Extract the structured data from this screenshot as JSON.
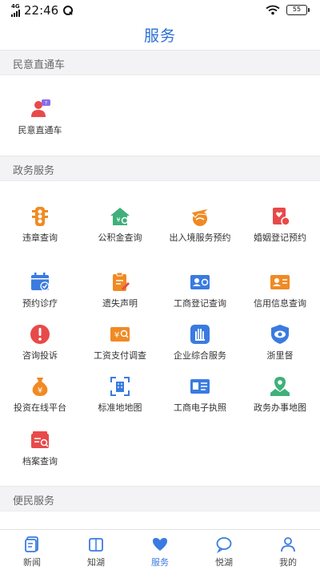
{
  "status": {
    "network": "4G",
    "network_sub": "HD",
    "time": "22:46",
    "battery": "55"
  },
  "page_title": "服务",
  "sections": [
    {
      "title": "民意直通车",
      "items": [
        {
          "label": "民意直通车",
          "icon": "feedback-person-icon"
        }
      ]
    },
    {
      "title": "政务服务",
      "items": [
        {
          "label": "违章查询",
          "icon": "traffic-light-icon"
        },
        {
          "label": "公积金查询",
          "icon": "housing-fund-icon"
        },
        {
          "label": "出入境服务预约",
          "icon": "airplane-globe-icon"
        },
        {
          "label": "婚姻登记预约",
          "icon": "marriage-cert-icon"
        },
        {
          "label": "预约诊疗",
          "icon": "calendar-check-icon"
        },
        {
          "label": "遗失声明",
          "icon": "lost-statement-icon"
        },
        {
          "label": "工商登记查询",
          "icon": "business-cert-icon"
        },
        {
          "label": "信用信息查询",
          "icon": "credit-card-icon"
        },
        {
          "label": "咨询投诉",
          "icon": "exclamation-icon"
        },
        {
          "label": "工资支付调查",
          "icon": "salary-search-icon"
        },
        {
          "label": "企业综合服务",
          "icon": "hand-icon"
        },
        {
          "label": "浙里督",
          "icon": "eye-shield-icon"
        },
        {
          "label": "投资在线平台",
          "icon": "money-bag-icon"
        },
        {
          "label": "标准地地图",
          "icon": "scan-building-icon"
        },
        {
          "label": "工商电子执照",
          "icon": "e-license-icon"
        },
        {
          "label": "政务办事地图",
          "icon": "map-pin-icon"
        },
        {
          "label": "档案查询",
          "icon": "archive-search-icon"
        }
      ]
    },
    {
      "title": "便民服务",
      "items": []
    }
  ],
  "bottom_nav": [
    {
      "label": "新闻",
      "icon": "news-icon",
      "active": false
    },
    {
      "label": "知湖",
      "icon": "book-icon",
      "active": false
    },
    {
      "label": "服务",
      "icon": "heart-icon",
      "active": true
    },
    {
      "label": "悦湖",
      "icon": "chat-icon",
      "active": false
    },
    {
      "label": "我的",
      "icon": "user-icon",
      "active": false
    }
  ],
  "colors": {
    "accent": "#2d6fd6",
    "orange": "#f08a24",
    "red": "#e84a4a",
    "green": "#3fb07a",
    "blue": "#3a7be0"
  }
}
